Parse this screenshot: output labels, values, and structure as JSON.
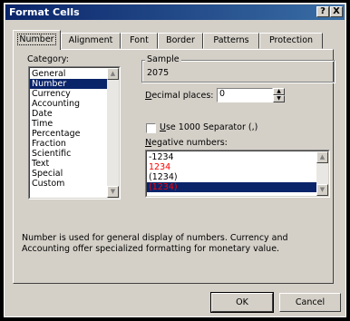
{
  "window": {
    "title": "Format Cells",
    "help_label": "?",
    "close_label": "X"
  },
  "tabs": [
    {
      "label": "Number",
      "active": true
    },
    {
      "label": "Alignment"
    },
    {
      "label": "Font"
    },
    {
      "label": "Border"
    },
    {
      "label": "Patterns"
    },
    {
      "label": "Protection"
    }
  ],
  "category": {
    "label": "Category:",
    "items": [
      "General",
      "Number",
      "Currency",
      "Accounting",
      "Date",
      "Time",
      "Percentage",
      "Fraction",
      "Scientific",
      "Text",
      "Special",
      "Custom"
    ],
    "selected": "Number"
  },
  "sample": {
    "label": "Sample",
    "value": "2075"
  },
  "decimal_places": {
    "label": "Decimal places:",
    "value": "0"
  },
  "separator": {
    "label": "Use 1000 Separator (,)",
    "checked": false
  },
  "negative_numbers": {
    "label": "Negative numbers:",
    "items": [
      {
        "text": "-1234",
        "color": "#000000"
      },
      {
        "text": "1234",
        "color": "#ff0000"
      },
      {
        "text": "(1234)",
        "color": "#000000"
      },
      {
        "text": "(1234)",
        "color": "#ff0000",
        "selected": true
      }
    ]
  },
  "description": "Number is used for general display of numbers.  Currency and Accounting offer specialized formatting for monetary value.",
  "buttons": {
    "ok": "OK",
    "cancel": "Cancel"
  },
  "colors": {
    "titlebar": "#0a246a",
    "face": "#d4d0c8",
    "selection": "#0a246a",
    "negative_red": "#ff0000"
  }
}
